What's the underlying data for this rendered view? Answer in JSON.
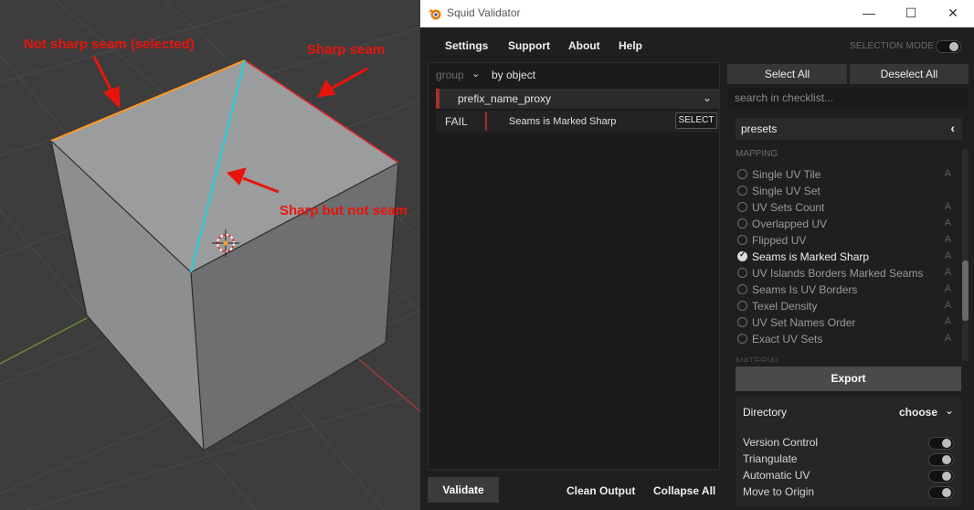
{
  "viewport": {
    "annotations": {
      "not_sharp_seam": "Not sharp seam (selected)",
      "sharp_seam": "Sharp seam",
      "sharp_not_seam": "Sharp but not seam"
    },
    "colors": {
      "background": "#3d3d3d",
      "cube_top": "#9a9b9c",
      "cube_left": "#8e8f90",
      "cube_right": "#6f7071",
      "selected_edge": "#ff9a22",
      "sharp_edge": "#e0282c",
      "seam_edge": "#20d0e0",
      "arrow": "#e8140c"
    }
  },
  "window": {
    "title": "Squid Validator",
    "controls": {
      "minimize": "—",
      "maximize": "☐",
      "close": "✕"
    }
  },
  "menu": {
    "items": [
      "Settings",
      "Support",
      "About",
      "Help"
    ],
    "selection_mode_label": "SELECTION MODE"
  },
  "results": {
    "group_label": "group",
    "group_value": "by object",
    "object_name": "prefix_name_proxy",
    "rows": [
      {
        "status": "FAIL",
        "message": "Seams is Marked Sharp",
        "action": "SELECT"
      }
    ]
  },
  "footer": {
    "validate": "Validate",
    "clean_output": "Clean Output",
    "collapse_all": "Collapse All"
  },
  "checklist_panel": {
    "select_all": "Select All",
    "deselect_all": "Deselect All",
    "search_placeholder": "search in checklist...",
    "presets_label": "presets",
    "section_header": "MAPPING",
    "next_section_header": "MATERIAL",
    "items": [
      {
        "label": "Single UV Tile",
        "auto": "A",
        "checked": false
      },
      {
        "label": "Single UV Set",
        "auto": "",
        "checked": false
      },
      {
        "label": "UV Sets Count",
        "auto": "A",
        "checked": false
      },
      {
        "label": "Overlapped UV",
        "auto": "A",
        "checked": false
      },
      {
        "label": "Flipped UV",
        "auto": "A",
        "checked": false
      },
      {
        "label": "Seams is Marked Sharp",
        "auto": "A",
        "checked": true
      },
      {
        "label": "UV Islands Borders Marked Seams",
        "auto": "A",
        "checked": false
      },
      {
        "label": "Seams Is UV Borders",
        "auto": "A",
        "checked": false
      },
      {
        "label": "Texel Density",
        "auto": "A",
        "checked": false
      },
      {
        "label": "UV Set Names Order",
        "auto": "A",
        "checked": false
      },
      {
        "label": "Exact UV Sets",
        "auto": "A",
        "checked": false
      }
    ],
    "export_label": "Export",
    "directory_label": "Directory",
    "directory_value": "choose",
    "options": [
      {
        "label": "Version Control",
        "on": false
      },
      {
        "label": "Triangulate",
        "on": false
      },
      {
        "label": "Automatic UV",
        "on": false
      },
      {
        "label": "Move to Origin",
        "on": false
      }
    ]
  }
}
